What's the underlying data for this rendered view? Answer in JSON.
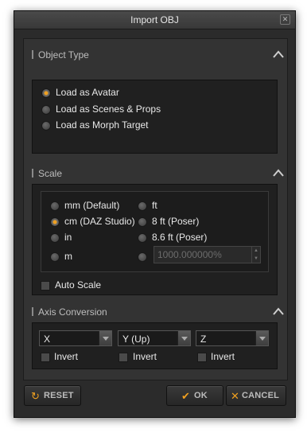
{
  "window": {
    "title": "Import OBJ",
    "close_icon": "close-icon"
  },
  "object_type": {
    "label": "Object Type",
    "options": [
      {
        "label": "Load as Avatar",
        "selected": true
      },
      {
        "label": "Load as Scenes & Props",
        "selected": false
      },
      {
        "label": "Load as Morph Target",
        "selected": false
      }
    ]
  },
  "scale": {
    "label": "Scale",
    "left_options": [
      {
        "label": "mm (Default)",
        "selected": false
      },
      {
        "label": "cm (DAZ Studio)",
        "selected": true
      },
      {
        "label": "in",
        "selected": false
      },
      {
        "label": "m",
        "selected": false
      }
    ],
    "right_options": [
      {
        "label": "ft",
        "selected": false
      },
      {
        "label": "8 ft (Poser)",
        "selected": false
      },
      {
        "label": "8.6 ft (Poser)",
        "selected": false
      },
      {
        "label": "",
        "selected": false
      }
    ],
    "custom_value": "1000.000000%",
    "auto_scale_label": "Auto Scale"
  },
  "axis_conversion": {
    "label": "Axis Conversion",
    "axes": [
      {
        "value": "X",
        "invert_label": "Invert"
      },
      {
        "value": "Y (Up)",
        "invert_label": "Invert"
      },
      {
        "value": "Z",
        "invert_label": "Invert"
      }
    ]
  },
  "buttons": {
    "reset": "RESET",
    "ok": "OK",
    "cancel": "CANCEL"
  },
  "colors": {
    "accent": "#f0a020",
    "background": "#2b2b2b",
    "panel": "#202020"
  }
}
